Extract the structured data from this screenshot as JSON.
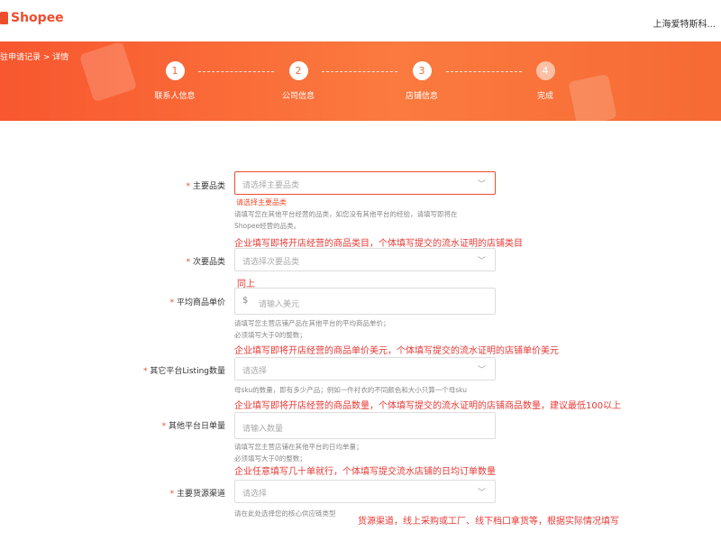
{
  "header": {
    "logo_text": "Shopee",
    "company": "上海爱特斯科..."
  },
  "banner": {
    "breadcrumb": "驻申请记录 > 详情"
  },
  "steps": [
    {
      "number": "1",
      "label": "联系人信息"
    },
    {
      "number": "2",
      "label": "公司信息"
    },
    {
      "number": "3",
      "label": "店铺信息"
    },
    {
      "number": "4",
      "label": "完成"
    }
  ],
  "form": {
    "main_category": {
      "required": "*",
      "label": "主要品类",
      "placeholder": "请选择主要品类",
      "error": "请选择主要品类",
      "hint1": "请填写您在其他平台经营的品类，如您没有其他平台的经验，请填写即将在",
      "hint2": "Shopee经营的品类。"
    },
    "secondary_category": {
      "required": "*",
      "label": "次要品类",
      "placeholder": "请选择次要品类"
    },
    "avg_price": {
      "required": "*",
      "label": "平均商品单价",
      "prefix": "$",
      "placeholder": "请输入美元",
      "hint1": "请填写您主营店铺产品在其他平台的平均商品单价；",
      "hint2": "必须填写大于0的整数；"
    },
    "listing_count": {
      "required": "*",
      "label": "其它平台Listing数量",
      "placeholder": "请选择",
      "hint1": "母sku的数量，即有多少产品；例如一件衬衣的不同颜色和大小只算一个母sku"
    },
    "daily_orders": {
      "required": "*",
      "label": "其他平台日单量",
      "placeholder": "请输入数量",
      "hint1": "请填写您主营店铺在其他平台的日均单量；",
      "hint2": "必须填写大于0的整数；"
    },
    "supply_channel": {
      "required": "*",
      "label": "主要货源渠道",
      "placeholder": "请选择",
      "hint1": "请在此处选择您的核心供应链类型"
    }
  },
  "notes": {
    "n1": "企业填写即将开店经营的商品类目，个体填写提交的流水证明的店铺类目",
    "n2": "同上",
    "n3": "企业填写即将开店经营的商品单价美元，个体填写提交的流水证明的店铺单价美元",
    "n4": "企业填写即将开店经营的商品数量，个体填写提交的流水证明的店铺商品数量，建议最低100以上",
    "n5": "企业任意填写几十单就行，个体填写提交流水店铺的日均订单数量",
    "n6": "货源渠道，线上采购或工厂、线下档口拿货等，根据实际情况填写"
  }
}
